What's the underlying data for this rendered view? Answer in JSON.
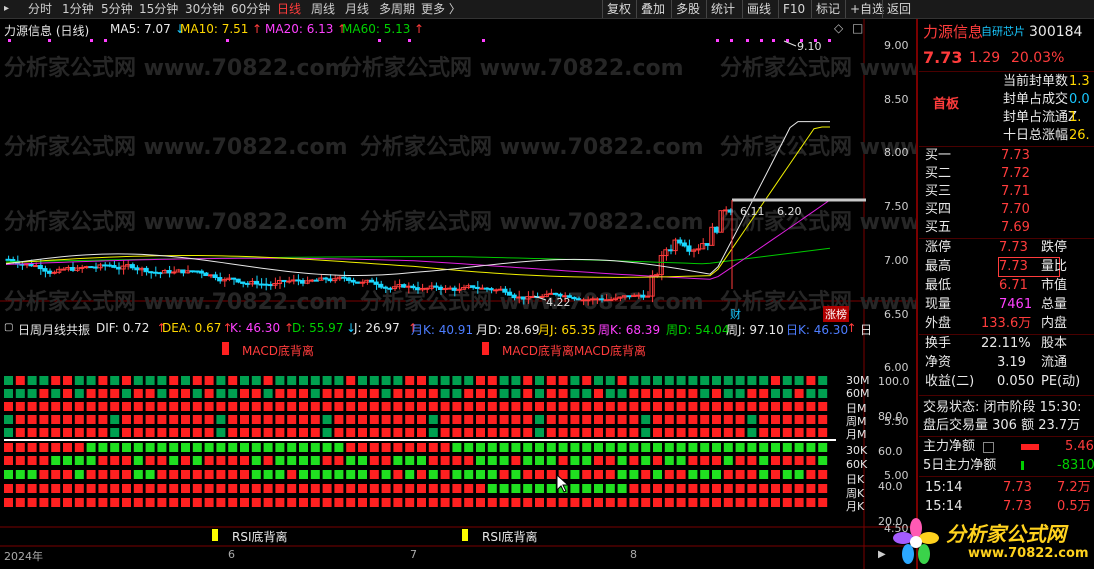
{
  "toolbar": {
    "left": [
      "分时",
      "1分钟",
      "5分钟",
      "15分钟",
      "30分钟",
      "60分钟",
      "日线",
      "周线",
      "月线",
      "多周期",
      "更多 〉"
    ],
    "active": "日线",
    "right": [
      "复权",
      "叠加",
      "多股",
      "统计",
      "画线",
      "F10",
      "标记",
      "+自选",
      "返回"
    ]
  },
  "main": {
    "title": "力源信息 (日线)",
    "ma": [
      {
        "label": "MA5: 7.07",
        "arrow": "↓",
        "color": "#e8e8e8"
      },
      {
        "label": "MA10: 7.51",
        "arrow": "↑",
        "color": "#ffd700"
      },
      {
        "label": "MA20: 6.13",
        "arrow": "↑",
        "color": "#ff40ff"
      },
      {
        "label": "MA60: 5.13",
        "arrow": "↑",
        "color": "#00d000"
      }
    ],
    "y_ticks": [
      "9.00",
      "8.50",
      "8.00",
      "7.50",
      "7.00",
      "6.50",
      "6.00",
      "5.50",
      "5.00",
      "4.50"
    ],
    "annotations": {
      "high": "9.10",
      "low": "4.22",
      "level_left": "6.11",
      "level_right": "6.20"
    },
    "tags": {
      "cai": "财",
      "zhangbang": "涨榜"
    },
    "watermark": "分析家公式网 www.70822.com"
  },
  "indicator": {
    "title": "日周月线共振",
    "values": [
      {
        "label": "DIF: 0.72",
        "arrow": "↑",
        "color": "#e8e8e8"
      },
      {
        "label": "DEA: 0.67",
        "arrow": "↑",
        "color": "#ffd700"
      },
      {
        "label": "K: 46.30",
        "arrow": "↑",
        "color": "#ff40ff"
      },
      {
        "label": "D: 55.97",
        "arrow": "↓",
        "color": "#00d000"
      },
      {
        "label": "J: 26.97",
        "arrow": "↑",
        "color": "#e8e8e8"
      },
      {
        "label": "月K: 40.91",
        "arrow": "",
        "color": "#4d7dff"
      },
      {
        "label": "月D: 28.69",
        "arrow": "",
        "color": "#e8e8e8"
      },
      {
        "label": "月J: 65.35",
        "arrow": "",
        "color": "#ffd700"
      },
      {
        "label": "周K: 68.39",
        "arrow": "",
        "color": "#ff40ff"
      },
      {
        "label": "周D: 54.04",
        "arrow": "",
        "color": "#00d000"
      },
      {
        "label": "周J: 97.10",
        "arrow": "",
        "color": "#e8e8e8"
      },
      {
        "label": "日K: 46.30",
        "arrow": "↑",
        "color": "#4d7dff"
      },
      {
        "label": "日",
        "arrow": "",
        "color": "#e8e8e8"
      }
    ],
    "macd_label": "MACD底背离",
    "macd_label2": "MACD底背离MACD底背离",
    "rsi_label": "RSI底背离",
    "row_labels_top": [
      "30M",
      "60M",
      "日M",
      "周M",
      "月M"
    ],
    "row_labels_bottom": [
      "30K",
      "60K",
      "日K",
      "周K",
      "月K"
    ],
    "y_ticks": [
      "100.0",
      "80.0",
      "60.0",
      "40.0",
      "20.0"
    ]
  },
  "dates": [
    "2024年",
    "6",
    "7",
    "8"
  ],
  "quote": {
    "name": "力源信息",
    "tag": "自研芯片",
    "code": "300184",
    "price": "7.73",
    "change": "1.29",
    "pct": "20.03%",
    "board": "首板",
    "seal": [
      {
        "k": "当前封单数",
        "v": "1.3"
      },
      {
        "k": "封单占成交",
        "v": "0.0"
      },
      {
        "k": "封单占流通Z",
        "v": "1."
      },
      {
        "k": "十日总涨幅",
        "v": "26."
      }
    ],
    "bids": [
      {
        "k": "买一",
        "v": "7.73"
      },
      {
        "k": "买二",
        "v": "7.72"
      },
      {
        "k": "买三",
        "v": "7.71"
      },
      {
        "k": "买四",
        "v": "7.70"
      },
      {
        "k": "买五",
        "v": "7.69"
      }
    ],
    "stats": [
      {
        "k1": "涨停",
        "v1": "7.73",
        "k2": "跌停"
      },
      {
        "k1": "最高",
        "v1": "7.73",
        "k2": "量比"
      },
      {
        "k1": "最低",
        "v1": "6.71",
        "k2": "市值"
      },
      {
        "k1": "现量",
        "v1": "7461",
        "k2": "总量"
      },
      {
        "k1": "外盘",
        "v1": "133.6万",
        "k2": "内盘"
      }
    ],
    "finance": [
      {
        "k1": "换手",
        "v1": "22.11%",
        "k2": "股本"
      },
      {
        "k1": "净资",
        "v1": "3.19",
        "k2": "流通"
      },
      {
        "k1": "收益(二)",
        "v1": "0.050",
        "k2": "PE(动)"
      }
    ],
    "trade_status": "交易状态: 闭市阶段 15:30:",
    "after_trade": "盘后交易量 306 额 23.7万",
    "main_net": {
      "k": "主力净额",
      "v": "5.46"
    },
    "main_net5": {
      "k": "5日主力净额",
      "v": "-8310"
    },
    "ticks": [
      {
        "t": "15:14",
        "p": "7.73",
        "v": "7.2万"
      },
      {
        "t": "15:14",
        "p": "7.73",
        "v": "0.5万"
      }
    ],
    "logo_text": "分析家公式网",
    "logo_url": "www.70822.com"
  }
}
